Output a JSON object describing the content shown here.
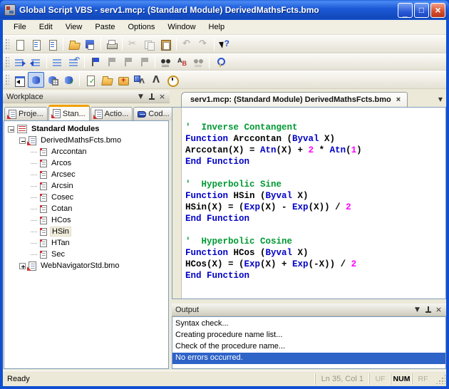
{
  "window": {
    "title": "Global Script VBS - serv1.mcp: (Standard Module) DerivedMathsFcts.bmo",
    "controls": [
      {
        "name": "minimize",
        "glyph": "_"
      },
      {
        "name": "maximize",
        "glyph": "□"
      },
      {
        "name": "close",
        "glyph": "×"
      }
    ]
  },
  "menu": {
    "items": [
      "File",
      "Edit",
      "View",
      "Paste",
      "Options",
      "Window",
      "Help"
    ]
  },
  "toolbars": {
    "rows": [
      {
        "items": [
          {
            "name": "new-document"
          },
          {
            "name": "import-script"
          },
          {
            "name": "export-script"
          },
          "sep",
          {
            "name": "open-project"
          },
          {
            "name": "save"
          },
          "sep",
          {
            "name": "print"
          },
          "sep",
          {
            "name": "cut",
            "disabled": true
          },
          {
            "name": "copy",
            "disabled": true
          },
          {
            "name": "paste"
          },
          "sep",
          {
            "name": "undo",
            "disabled": true
          },
          {
            "name": "redo",
            "disabled": true
          },
          "sep",
          {
            "name": "context-help"
          }
        ]
      },
      {
        "items": [
          {
            "name": "indent"
          },
          {
            "name": "outdent"
          },
          "sep",
          {
            "name": "format-lines"
          },
          {
            "name": "format-undo"
          },
          "sep",
          {
            "name": "bookmark"
          },
          {
            "name": "add-bookmark",
            "disabled": true
          },
          {
            "name": "next-bookmark",
            "disabled": true
          },
          {
            "name": "prev-bookmark",
            "disabled": true
          },
          "sep",
          {
            "name": "find-in-files"
          },
          {
            "name": "replace"
          },
          {
            "name": "find-next",
            "disabled": true
          },
          "sep",
          {
            "name": "options-key"
          }
        ]
      },
      {
        "items": [
          {
            "name": "toggle-workspace"
          },
          {
            "name": "database",
            "pressed": true
          },
          {
            "name": "database-options"
          },
          {
            "name": "database-check"
          },
          "sep",
          {
            "name": "syntax-check"
          },
          {
            "name": "open-folder"
          },
          {
            "name": "first-aid"
          },
          {
            "name": "compass-cube"
          },
          {
            "name": "compass"
          },
          {
            "name": "clock"
          }
        ]
      }
    ]
  },
  "workplace": {
    "title": "Workplace",
    "header_buttons": {
      "dropdown": "▼",
      "close": "×"
    },
    "tabs": [
      {
        "label": "Proje...",
        "icon": "script",
        "active": false
      },
      {
        "label": "Stan...",
        "icon": "script",
        "active": true
      },
      {
        "label": "Actio...",
        "icon": "script-action",
        "active": false
      },
      {
        "label": "Cod...",
        "icon": "code-book",
        "active": false
      }
    ],
    "tree": [
      {
        "label": "Standard Modules",
        "level": 0,
        "icon": "modules",
        "expander": "-",
        "bold": true
      },
      {
        "label": "DerivedMathsFcts.bmo",
        "level": 1,
        "icon": "module",
        "expander": "-"
      },
      {
        "label": "Arccontan",
        "level": 2,
        "icon": "procedure"
      },
      {
        "label": "Arcos",
        "level": 2,
        "icon": "procedure"
      },
      {
        "label": "Arcsec",
        "level": 2,
        "icon": "procedure"
      },
      {
        "label": "Arcsin",
        "level": 2,
        "icon": "procedure"
      },
      {
        "label": "Cosec",
        "level": 2,
        "icon": "procedure"
      },
      {
        "label": "Cotan",
        "level": 2,
        "icon": "procedure"
      },
      {
        "label": "HCos",
        "level": 2,
        "icon": "procedure"
      },
      {
        "label": "HSin",
        "level": 2,
        "icon": "procedure",
        "selected": true
      },
      {
        "label": "HTan",
        "level": 2,
        "icon": "procedure"
      },
      {
        "label": "Sec",
        "level": 2,
        "icon": "procedure"
      },
      {
        "label": "WebNavigatorStd.bmo",
        "level": 1,
        "icon": "module",
        "expander": "+"
      }
    ]
  },
  "editor": {
    "tab": "serv1.mcp: (Standard Module) DerivedMathsFcts.bmo",
    "tab_close": "×",
    "dropdown": "▼",
    "code": [
      {
        "segs": []
      },
      {
        "segs": [
          {
            "t": "'  Inverse Contangent",
            "c": "com"
          }
        ]
      },
      {
        "segs": [
          {
            "t": "Function",
            "c": "kw"
          },
          {
            "t": " Arccontan (",
            "c": "pl"
          },
          {
            "t": "Byval",
            "c": "kw"
          },
          {
            "t": " X)",
            "c": "pl"
          }
        ]
      },
      {
        "segs": [
          {
            "t": "Arccotan(X) = ",
            "c": "pl"
          },
          {
            "t": "Atn",
            "c": "kw"
          },
          {
            "t": "(X) + ",
            "c": "pl"
          },
          {
            "t": "2",
            "c": "num"
          },
          {
            "t": " ",
            "c": "pl"
          },
          {
            "t": "*",
            "c": "op"
          },
          {
            "t": " ",
            "c": "pl"
          },
          {
            "t": "Atn",
            "c": "kw"
          },
          {
            "t": "(",
            "c": "pl"
          },
          {
            "t": "1",
            "c": "num"
          },
          {
            "t": ")",
            "c": "pl"
          }
        ]
      },
      {
        "segs": [
          {
            "t": "End Function",
            "c": "kw"
          }
        ]
      },
      {
        "segs": []
      },
      {
        "segs": [
          {
            "t": "'  Hyperbolic Sine",
            "c": "com"
          }
        ]
      },
      {
        "segs": [
          {
            "t": "Function",
            "c": "kw"
          },
          {
            "t": " HSin (",
            "c": "pl"
          },
          {
            "t": "Byval",
            "c": "kw"
          },
          {
            "t": " X)",
            "c": "pl"
          }
        ]
      },
      {
        "segs": [
          {
            "t": "HSin(X) = (",
            "c": "pl"
          },
          {
            "t": "Exp",
            "c": "kw"
          },
          {
            "t": "(X) - ",
            "c": "pl"
          },
          {
            "t": "Exp",
            "c": "kw"
          },
          {
            "t": "(X)) ",
            "c": "pl"
          },
          {
            "t": "/",
            "c": "op"
          },
          {
            "t": " ",
            "c": "pl"
          },
          {
            "t": "2",
            "c": "num"
          }
        ]
      },
      {
        "segs": [
          {
            "t": "End Function",
            "c": "kw"
          }
        ]
      },
      {
        "segs": []
      },
      {
        "segs": [
          {
            "t": "'  Hyperbolic Cosine",
            "c": "com"
          }
        ]
      },
      {
        "segs": [
          {
            "t": "Function",
            "c": "kw"
          },
          {
            "t": " HCos (",
            "c": "pl"
          },
          {
            "t": "Byval",
            "c": "kw"
          },
          {
            "t": " X)",
            "c": "pl"
          }
        ]
      },
      {
        "segs": [
          {
            "t": "HCos(X) = (",
            "c": "pl"
          },
          {
            "t": "Exp",
            "c": "kw"
          },
          {
            "t": "(X) + ",
            "c": "pl"
          },
          {
            "t": "Exp",
            "c": "kw"
          },
          {
            "t": "(-X)) ",
            "c": "pl"
          },
          {
            "t": "/",
            "c": "op"
          },
          {
            "t": " ",
            "c": "pl"
          },
          {
            "t": "2",
            "c": "num"
          }
        ]
      },
      {
        "segs": [
          {
            "t": "End Function",
            "c": "kw"
          }
        ]
      }
    ]
  },
  "output": {
    "title": "Output",
    "header_buttons": {
      "dropdown": "▼",
      "close": "×"
    },
    "lines": [
      {
        "text": "Syntax check...",
        "selected": false
      },
      {
        "text": "Creating procedure name list...",
        "selected": false
      },
      {
        "text": "Check of the procedure name...",
        "selected": false
      },
      {
        "text": "No errors occurred.",
        "selected": true
      }
    ]
  },
  "status_bar": {
    "message": "Ready",
    "cursor_position": "Ln 35, Col 1",
    "indicators": [
      {
        "label": "UF",
        "dim": true
      },
      {
        "label": "NUM",
        "dim": false
      },
      {
        "label": "RF",
        "dim": true
      }
    ]
  },
  "colors": {
    "titlebar_blue": "#1c5ad8",
    "keyword_blue": "#0000c8",
    "comment_green": "#009933",
    "number_magenta": "#ff00ff",
    "selection_blue": "#2e63c8",
    "active_tab_orange": "#f0a000"
  }
}
